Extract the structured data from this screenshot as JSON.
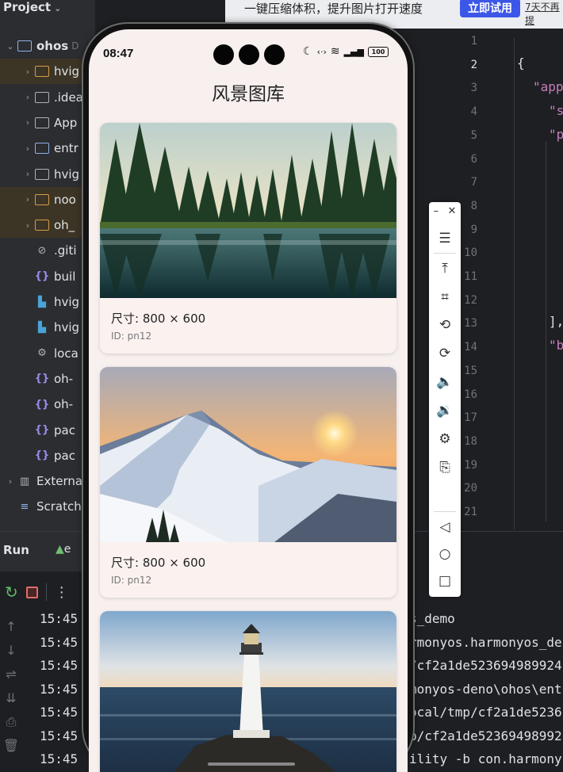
{
  "ide": {
    "project_label": "Project",
    "project_chevron": "⌄",
    "tree": [
      {
        "arrow": "⌄",
        "icon": "module-folder",
        "label": "ohos",
        "dim": "D",
        "hl": false,
        "bold": true
      },
      {
        "arrow": "›",
        "icon": "folder-orange",
        "label": "hvig",
        "hl": true
      },
      {
        "arrow": "›",
        "icon": "folder",
        "label": ".idea",
        "hl": false
      },
      {
        "arrow": "›",
        "icon": "folder",
        "label": "App",
        "hl": false
      },
      {
        "arrow": "›",
        "icon": "module-folder",
        "label": "entr",
        "hl": false
      },
      {
        "arrow": "›",
        "icon": "folder",
        "label": "hvig",
        "hl": false
      },
      {
        "arrow": "›",
        "icon": "folder-orange",
        "label": "noo",
        "hl": true
      },
      {
        "arrow": "›",
        "icon": "folder-orange",
        "label": "oh_",
        "hl": true
      },
      {
        "arrow": "",
        "icon": "ignore",
        "label": ".giti",
        "hl": false
      },
      {
        "arrow": "",
        "icon": "json",
        "label": "buil",
        "hl": false
      },
      {
        "arrow": "",
        "icon": "hvigor",
        "label": "hvig",
        "hl": false
      },
      {
        "arrow": "",
        "icon": "hvigor",
        "label": "hvig",
        "hl": false
      },
      {
        "arrow": "",
        "icon": "settings",
        "label": "loca",
        "hl": false
      },
      {
        "arrow": "",
        "icon": "json",
        "label": "oh-",
        "hl": false
      },
      {
        "arrow": "",
        "icon": "json",
        "label": "oh-",
        "hl": false
      },
      {
        "arrow": "",
        "icon": "json",
        "label": "pac",
        "hl": false
      },
      {
        "arrow": "",
        "icon": "json",
        "label": "pac",
        "hl": false
      },
      {
        "arrow": "›",
        "icon": "library",
        "label": "Externa",
        "hl": false
      },
      {
        "arrow": "",
        "icon": "scratch",
        "label": "Scratch",
        "hl": false
      }
    ],
    "run": {
      "label": "Run",
      "tab_icon": "▲",
      "tab_text": "e",
      "timestamps": [
        "15:45",
        "15:45",
        "15:45",
        "15:45",
        "15:45",
        "15:45",
        "15:45"
      ],
      "right_lines": [
        "s_demo",
        "rmonyos.harmonyos_de",
        "/cf2a1de523694989924",
        "monyos-deno\\ohos\\ent",
        "ocal/tmp/cf2a1de5236",
        "p/cf2a1de52369498992",
        "ility -b con.harmony"
      ]
    },
    "editor": {
      "line_numbers": [
        "1",
        "2",
        "3",
        "4",
        "5",
        "6",
        "7",
        "8",
        "9",
        "10",
        "11",
        "12",
        "13",
        "14",
        "15",
        "16",
        "17",
        "18",
        "19",
        "20",
        "21"
      ],
      "current_line": "2",
      "code_brace": "{",
      "code_app": "\"app",
      "code_s": "\"s",
      "code_p": "\"p",
      "code_close": "],",
      "code_b": "\"b"
    }
  },
  "banner": {
    "text": "一键压缩体积，提升图片打开速度",
    "button": "立即试用",
    "link": "7天不再提"
  },
  "toolbar": {
    "minimize": "–",
    "close": "✕",
    "buttons": [
      "menu-icon",
      "pin-top-icon",
      "crop-icon",
      "rotate-left-icon",
      "rotate-right-icon",
      "volume-up-icon",
      "volume-down-icon",
      "settings-icon",
      "screenshot-icon",
      "back-icon",
      "home-icon",
      "recents-icon"
    ]
  },
  "phone": {
    "time": "08:47",
    "title": "风景图库",
    "cards": [
      {
        "size": "尺寸: 800 × 600",
        "id": "ID: pn12",
        "scene": "forest-lake"
      },
      {
        "size": "尺寸: 800 × 600",
        "id": "ID: pn12",
        "scene": "mountain-sunset"
      },
      {
        "size": "",
        "id": "",
        "scene": "lighthouse"
      }
    ]
  }
}
